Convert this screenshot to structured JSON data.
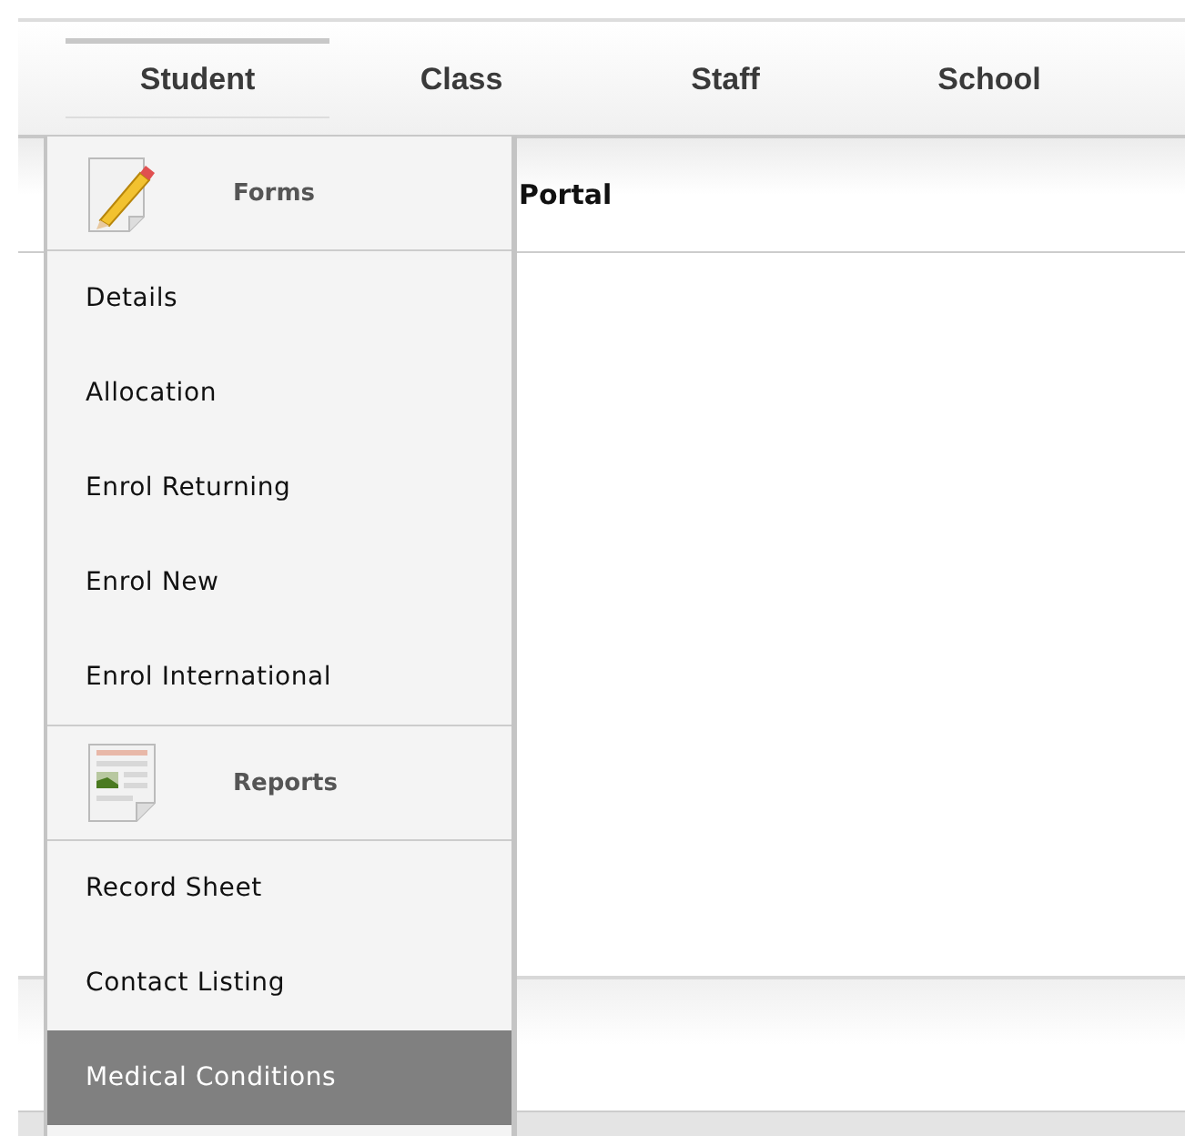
{
  "nav": {
    "tabs": [
      {
        "label": "Student",
        "selected": true
      },
      {
        "label": "Class",
        "selected": false
      },
      {
        "label": "Staff",
        "selected": false
      },
      {
        "label": "School",
        "selected": false
      }
    ]
  },
  "page_header": {
    "title": "Portal"
  },
  "menu": {
    "sections": [
      {
        "kind": "forms",
        "title": "Forms",
        "items": [
          {
            "label": "Details",
            "selected": false
          },
          {
            "label": "Allocation",
            "selected": false
          },
          {
            "label": "Enrol Returning",
            "selected": false
          },
          {
            "label": "Enrol New",
            "selected": false
          },
          {
            "label": "Enrol International",
            "selected": false
          }
        ]
      },
      {
        "kind": "reports",
        "title": "Reports",
        "items": [
          {
            "label": "Record Sheet",
            "selected": false
          },
          {
            "label": "Contact Listing",
            "selected": false
          },
          {
            "label": "Medical Conditions",
            "selected": true
          }
        ]
      }
    ]
  }
}
